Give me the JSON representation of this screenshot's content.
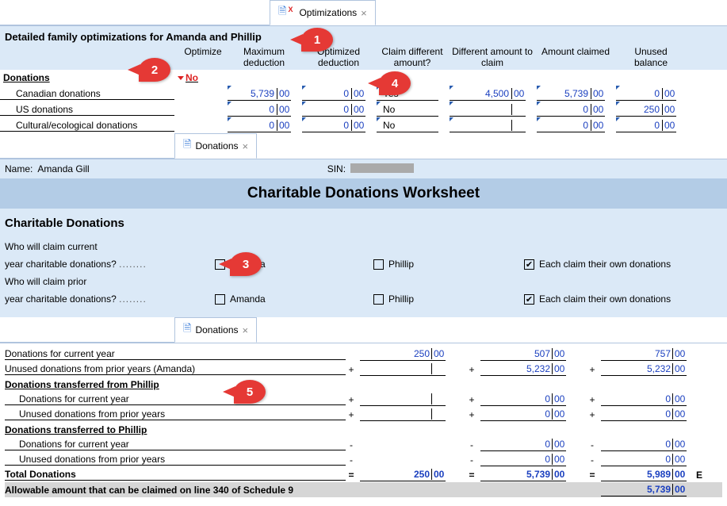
{
  "tabs": {
    "optimizations": "Optimizations",
    "donations": "Donations"
  },
  "header_title": "Detailed family optimizations for Amanda and Phillip",
  "cols": {
    "optimize": "Optimize",
    "max_ded": "Maximum deduction",
    "opt_ded": "Optimized deduction",
    "claim_diff": "Claim different amount?",
    "diff_amt": "Different amount to claim",
    "amt_claimed": "Amount claimed",
    "unused": "Unused balance"
  },
  "optimize_val": "No",
  "section_label": "Donations",
  "rows": [
    {
      "label": "Canadian donations",
      "max": "5,739",
      "opt": "0",
      "claim": "Yes",
      "diff": "4,500",
      "claimed": "5,739",
      "unused": "0"
    },
    {
      "label": "US donations",
      "max": "0",
      "opt": "0",
      "claim": "No",
      "diff": "",
      "claimed": "0",
      "unused": "250"
    },
    {
      "label": "Cultural/ecological donations",
      "max": "0",
      "opt": "0",
      "claim": "No",
      "diff": "",
      "claimed": "0",
      "unused": "0"
    }
  ],
  "cents": "00",
  "name_label": "Name:",
  "name_value": "Amanda Gill",
  "sin_label": "SIN:",
  "ws_title": "Charitable Donations Worksheet",
  "cd_title": "Charitable Donations",
  "q1a": "Who will claim current",
  "q1b": "year charitable donations?",
  "q2a": "Who will claim prior",
  "q2b": "year charitable donations?",
  "opt_amanda": "Amanda",
  "opt_phillip": "Phillip",
  "opt_each": "Each claim their own donations",
  "ws": {
    "r1": {
      "label": "Donations for current year",
      "a": "250",
      "b": "507",
      "c": "757"
    },
    "r2": {
      "label": "Unused donations from prior years (Amanda)",
      "a": "",
      "b": "5,232",
      "c": "5,232"
    },
    "r3_hdr": "Donations transferred from Phillip",
    "r3": {
      "label": "Donations for current year",
      "a": "",
      "b": "0",
      "c": "0"
    },
    "r4": {
      "label": "Unused donations from prior years",
      "a": "",
      "b": "0",
      "c": "0"
    },
    "r5_hdr": "Donations transferred to Phillip",
    "r5": {
      "label": "Donations for current year",
      "a": "",
      "b": "0",
      "c": "0"
    },
    "r6": {
      "label": "Unused donations from prior years",
      "a": "",
      "b": "0",
      "c": "0"
    },
    "total": {
      "label": "Total Donations",
      "a": "250",
      "b": "5,739",
      "c": "5,989"
    },
    "allow": {
      "label": "Allowable amount that can be claimed on line 340 of Schedule 9",
      "c": "5,739"
    },
    "suffix": "E"
  },
  "callouts": {
    "c1": "1",
    "c2": "2",
    "c3": "3",
    "c4": "4",
    "c5": "5"
  }
}
